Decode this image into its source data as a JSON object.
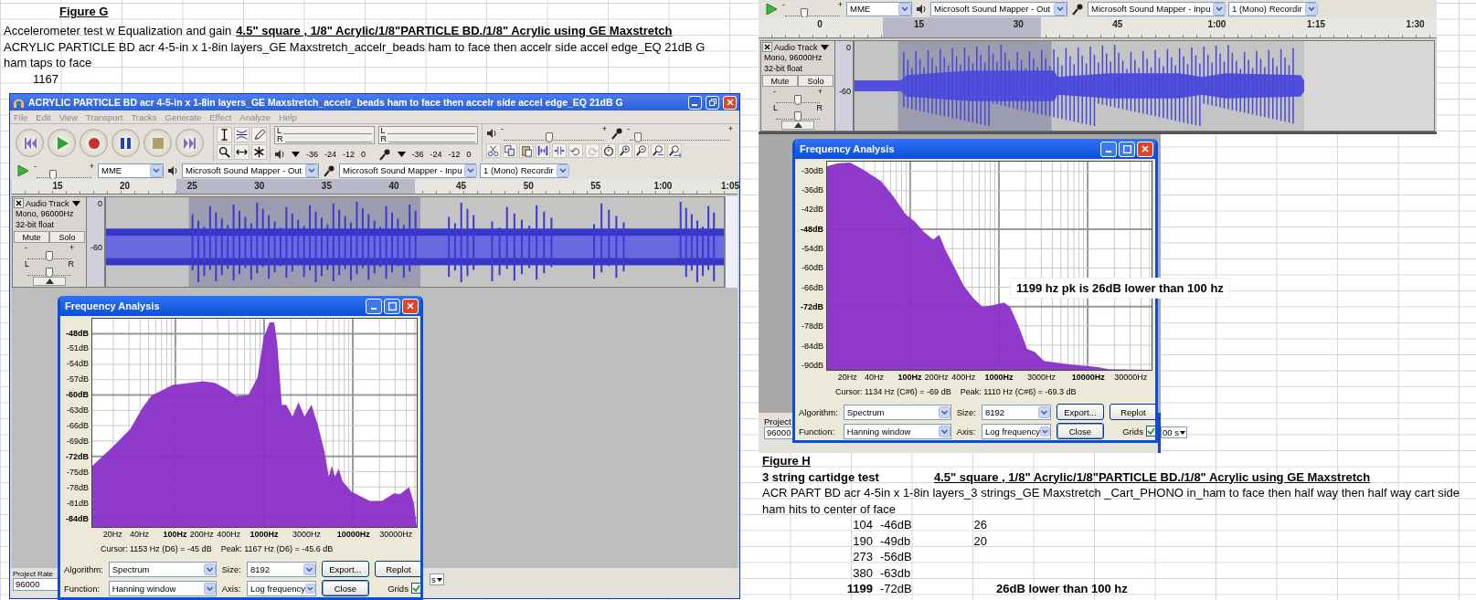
{
  "figure_g": {
    "title": "Figure G",
    "intro": "Accelerometer test w Equalization and gain",
    "heading": "4.5\" square , 1/8\" Acrylic/1/8\"PARTICLE BD./1/8\" Acrylic  using GE Maxstretch",
    "description": "ACRYLIC PARTICLE BD acr 4-5-in x 1-8in layers_GE Maxstretch_accelr_beads ham to face then accelr side accel edge_EQ 21dB G",
    "description_cont": "ham taps to face",
    "value": "1167"
  },
  "audacity_left": {
    "title": "ACRYLIC PARTICLE BD acr 4-5-in x 1-8in layers_GE Maxstretch_accelr_beads ham to face then accelr side accel edge_EQ 21dB G",
    "menu": [
      "File",
      "Edit",
      "View",
      "Transport",
      "Tracks",
      "Generate",
      "Effect",
      "Analyze",
      "Help"
    ],
    "meters": [
      {
        "channels": [
          "L",
          "R"
        ],
        "scale": [
          "-36",
          "-24",
          "-12",
          "0"
        ]
      },
      {
        "channels": [
          "L",
          "R"
        ],
        "scale": [
          "-36",
          "-24",
          "-12",
          "0"
        ]
      }
    ],
    "output_slider": {
      "min": "-",
      "max": "+",
      "level": 0.45
    },
    "input_slider": {
      "min": "-",
      "max": "+",
      "level": 0.08
    },
    "speed_slider": {
      "min": "-",
      "max": "+",
      "level": 0.3
    },
    "devices": {
      "host": "MME",
      "output": "Microsoft Sound Mapper - Out",
      "input": "Microsoft Sound Mapper - Inpu",
      "channels": "1 (Mono) Recordir"
    },
    "ruler": [
      "15",
      "20",
      "25",
      "30",
      "35",
      "40",
      "45",
      "50",
      "55",
      "1:00",
      "1:05"
    ],
    "track": {
      "name": "Audio Track",
      "format": "Mono, 96000Hz",
      "depth": "32-bit float",
      "mute": "Mute",
      "solo": "Solo",
      "scale": [
        "0",
        "-60"
      ],
      "gain": {
        "min": "-",
        "max": "+",
        "level": 0.5
      },
      "pan": {
        "min": "L",
        "max": "R",
        "level": 0.5
      }
    },
    "project_rate": {
      "label": "Project Rate",
      "value": "96000"
    },
    "selection_fragment": "s"
  },
  "frequency_left": {
    "title": "Frequency Analysis",
    "y_labels": [
      {
        "label": "-48dB",
        "major": true
      },
      {
        "label": "-51dB",
        "major": false
      },
      {
        "label": "-54dB",
        "major": false
      },
      {
        "label": "-57dB",
        "major": false
      },
      {
        "label": "-60dB",
        "major": true
      },
      {
        "label": "-63dB",
        "major": false
      },
      {
        "label": "-66dB",
        "major": false
      },
      {
        "label": "-69dB",
        "major": false
      },
      {
        "label": "-72dB",
        "major": true
      },
      {
        "label": "-75dB",
        "major": false
      },
      {
        "label": "-78dB",
        "major": false
      },
      {
        "label": "-81dB",
        "major": false
      },
      {
        "label": "-84dB",
        "major": true
      }
    ],
    "x_labels": [
      {
        "label": "20Hz",
        "major": false
      },
      {
        "label": "40Hz",
        "major": false
      },
      {
        "label": "100Hz",
        "major": true
      },
      {
        "label": "200Hz",
        "major": false
      },
      {
        "label": "400Hz",
        "major": false
      },
      {
        "label": "1000Hz",
        "major": true
      },
      {
        "label": "3000Hz",
        "major": false
      },
      {
        "label": "10000Hz",
        "major": true
      },
      {
        "label": "30000Hz",
        "major": false
      }
    ],
    "cursor": "Cursor: 1153 Hz (D6) = -45 dB",
    "peak": "Peak: 1167 Hz (D6) = -45.6 dB",
    "algorithm": {
      "label": "Algorithm:",
      "value": "Spectrum"
    },
    "size": {
      "label": "Size:",
      "value": "8192"
    },
    "function": {
      "label": "Function:",
      "value": "Hanning window"
    },
    "axis": {
      "label": "Axis:",
      "value": "Log frequency"
    },
    "buttons": [
      {
        "label": "Export...",
        "default": false
      },
      {
        "label": "Replot",
        "default": false
      },
      {
        "label": "Close",
        "default": true
      }
    ],
    "grids": {
      "label": "Grids",
      "checked": true
    }
  },
  "audacity_right": {
    "speed_slider": {
      "min": "-",
      "max": "+",
      "level": 0.35
    },
    "devices": {
      "host": "MME",
      "output": "Microsoft Sound Mapper - Out",
      "input": "Microsoft Sound Mapper - Inpu",
      "channels": "1 (Mono) Recordir"
    },
    "ruler": [
      "0",
      "15",
      "30",
      "45",
      "1:00",
      "1:15",
      "1:30"
    ],
    "track": {
      "name": "Audio Track",
      "format": "Mono, 96000Hz",
      "depth": "32-bit float",
      "mute": "Mute",
      "solo": "Solo",
      "scale": [
        "0",
        "-60"
      ],
      "gain": {
        "min": "-",
        "max": "+",
        "level": 0.5
      },
      "pan": {
        "min": "L",
        "max": "R",
        "level": 0.5
      }
    },
    "project_rate": {
      "label": "Project",
      "value": "96000"
    },
    "selection_fragment": "00 s"
  },
  "frequency_right": {
    "title": "Frequency Analysis",
    "y_labels": [
      {
        "label": "-30dB",
        "major": false
      },
      {
        "label": "-36dB",
        "major": false
      },
      {
        "label": "-42dB",
        "major": false
      },
      {
        "label": "-48dB",
        "major": true
      },
      {
        "label": "-54dB",
        "major": false
      },
      {
        "label": "-60dB",
        "major": false
      },
      {
        "label": "-66dB",
        "major": false
      },
      {
        "label": "-72dB",
        "major": true
      },
      {
        "label": "-78dB",
        "major": false
      },
      {
        "label": "-84dB",
        "major": false
      },
      {
        "label": "-90dB",
        "major": false
      }
    ],
    "x_labels": [
      {
        "label": "20Hz",
        "major": false
      },
      {
        "label": "40Hz",
        "major": false
      },
      {
        "label": "100Hz",
        "major": true
      },
      {
        "label": "200Hz",
        "major": false
      },
      {
        "label": "400Hz",
        "major": false
      },
      {
        "label": "1000Hz",
        "major": true
      },
      {
        "label": "3000Hz",
        "major": false
      },
      {
        "label": "10000Hz",
        "major": true
      },
      {
        "label": "30000Hz",
        "major": false
      }
    ],
    "cursor": "Cursor: 1134 Hz (C#6) = -69 dB",
    "peak": "Peak: 1110 Hz (C#6) = -69.3 dB",
    "algorithm": {
      "label": "Algorithm:",
      "value": "Spectrum"
    },
    "size": {
      "label": "Size:",
      "value": "8192"
    },
    "function": {
      "label": "Function:",
      "value": "Hanning window"
    },
    "axis": {
      "label": "Axis:",
      "value": "Log frequency"
    },
    "buttons": [
      {
        "label": "Export...",
        "default": false
      },
      {
        "label": "Replot",
        "default": false
      },
      {
        "label": "Close",
        "default": true
      }
    ],
    "grids": {
      "label": "Grids",
      "checked": true
    },
    "callout": "1199 hz pk is 26dB lower than 100 hz"
  },
  "figure_h": {
    "title": "Figure H",
    "test": "3 string cartidge test",
    "heading": "4.5\" square , 1/8\" Acrylic/1/8\"PARTICLE BD./1/8\" Acrylic  using GE Maxstretch",
    "description": "ACR PART BD acr 4-5in x 1-8in layers_3 strings_GE Maxstretch _Cart_PHONO in_ham to face then half way  then half way cart side",
    "description_cont": "ham hits to center of face",
    "table": [
      {
        "freq": "104",
        "db": "-46dB",
        "diff": "26",
        "bold": false
      },
      {
        "freq": "190",
        "db": "-49db",
        "diff": "20",
        "bold": false
      },
      {
        "freq": "273",
        "db": "-56dB",
        "bold": false
      },
      {
        "freq": "380",
        "db": "-63db",
        "bold": false
      },
      {
        "freq": "1199",
        "db": "-72dB",
        "note": "26dB lower than 100 hz",
        "bold": true
      }
    ]
  }
}
